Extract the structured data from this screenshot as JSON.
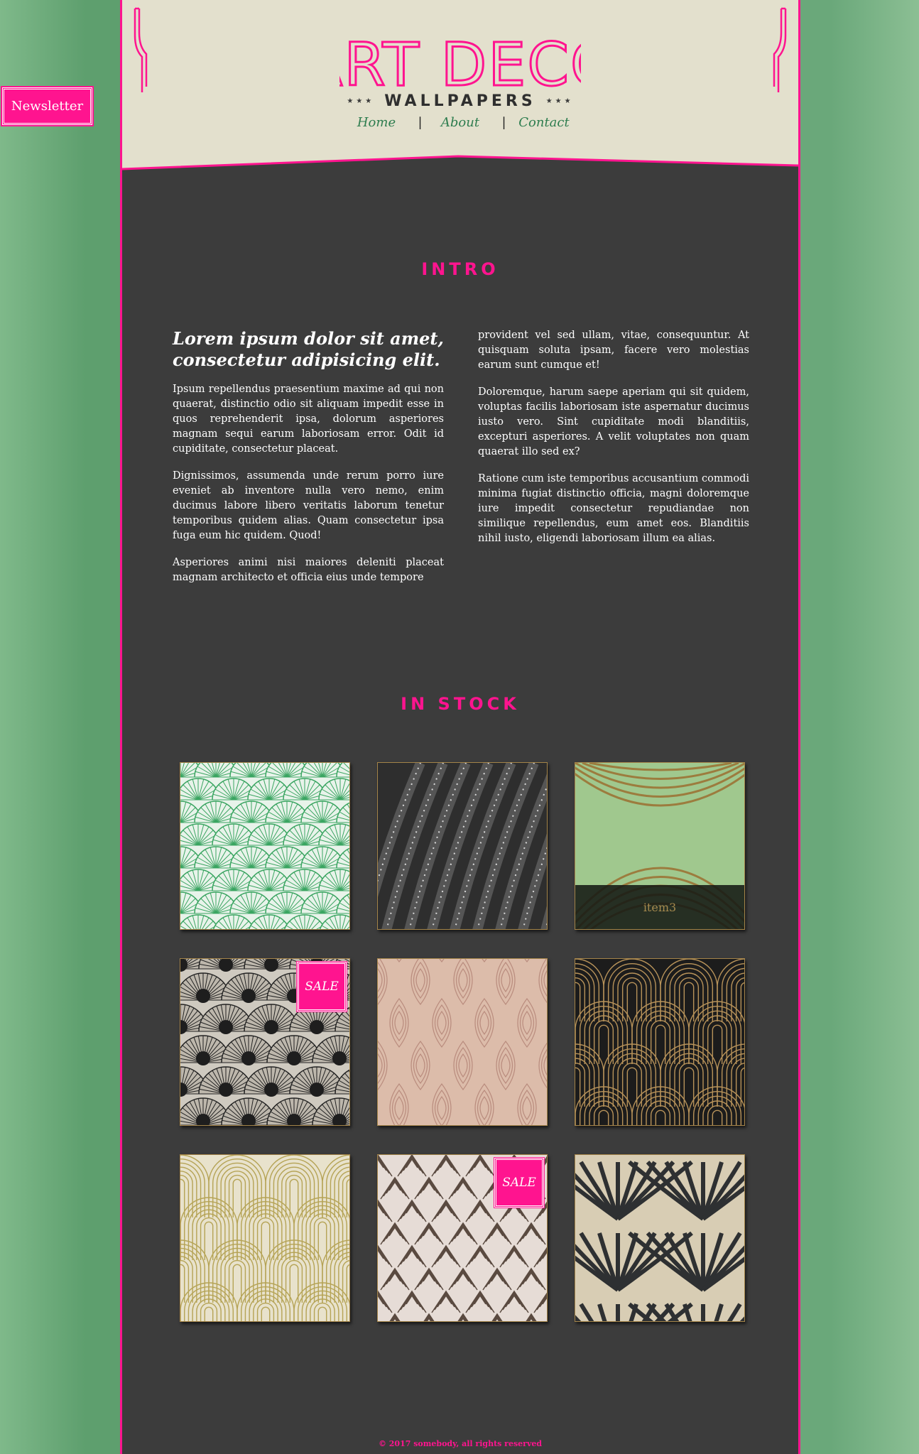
{
  "newsletter": {
    "label": "Newsletter"
  },
  "header": {
    "logo_title": "ART DECO",
    "logo_subtitle": "WALLPAPERS",
    "nav": [
      {
        "label": "Home"
      },
      {
        "label": "About"
      },
      {
        "label": "Contact"
      }
    ]
  },
  "intro": {
    "section_title": "INTRO",
    "heading": "Lorem ipsum dolor sit amet, consectetur adipisicing elit.",
    "left_paragraphs": [
      "Ipsum repellendus praesentium maxime ad qui non quaerat, distinctio odio sit aliquam impedit esse in quos reprehenderit ipsa, dolorum asperiores magnam sequi earum laboriosam error. Odit id cupiditate, consectetur placeat.",
      "Dignissimos, assumenda unde rerum porro iure eveniet ab inventore nulla vero nemo, enim ducimus labore libero veritatis laborum tenetur temporibus quidem alias. Quam consectetur ipsa fuga eum hic quidem. Quod!",
      "Asperiores animi nisi maiores deleniti placeat magnam architecto et officia eius unde tempore"
    ],
    "right_paragraphs": [
      "provident vel sed ullam, vitae, consequuntur. At quisquam soluta ipsam, facere vero molestias earum sunt cumque et!",
      "Doloremque, harum saepe aperiam qui sit quidem, voluptas facilis laboriosam iste aspernatur ducimus iusto vero. Sint cupiditate modi blanditiis, excepturi asperiores. A velit voluptates non quam quaerat illo sed ex?",
      "Ratione cum iste temporibus accusantium commodi minima fugiat distinctio officia, magni doloremque iure impedit consectetur repudiandae non similique repellendus, eum amet eos. Blanditiis nihil iusto, eligendi laboriosam illum ea alias."
    ]
  },
  "stock": {
    "section_title": "IN STOCK",
    "sale_label": "SALE",
    "items": [
      {
        "pattern": "green-fans",
        "sale": false,
        "caption": ""
      },
      {
        "pattern": "dark-dotted-feathers",
        "sale": false,
        "caption": ""
      },
      {
        "pattern": "green-gold-arches",
        "sale": false,
        "caption": "item3"
      },
      {
        "pattern": "black-silver-fans",
        "sale": true,
        "caption": ""
      },
      {
        "pattern": "pink-ogee",
        "sale": false,
        "caption": ""
      },
      {
        "pattern": "black-gold-arches",
        "sale": false,
        "caption": ""
      },
      {
        "pattern": "gold-cream-arches",
        "sale": false,
        "caption": ""
      },
      {
        "pattern": "bronze-chevrons",
        "sale": true,
        "caption": ""
      },
      {
        "pattern": "black-cream-leaves",
        "sale": false,
        "caption": ""
      }
    ]
  },
  "footer": {
    "text": "© 2017 somebody, all rights reserved"
  },
  "colors": {
    "accent": "#ff148f",
    "nav_green": "#2e7d4f",
    "page_bg": "#3c3c3c",
    "header_bg": "#e3e0cd"
  }
}
